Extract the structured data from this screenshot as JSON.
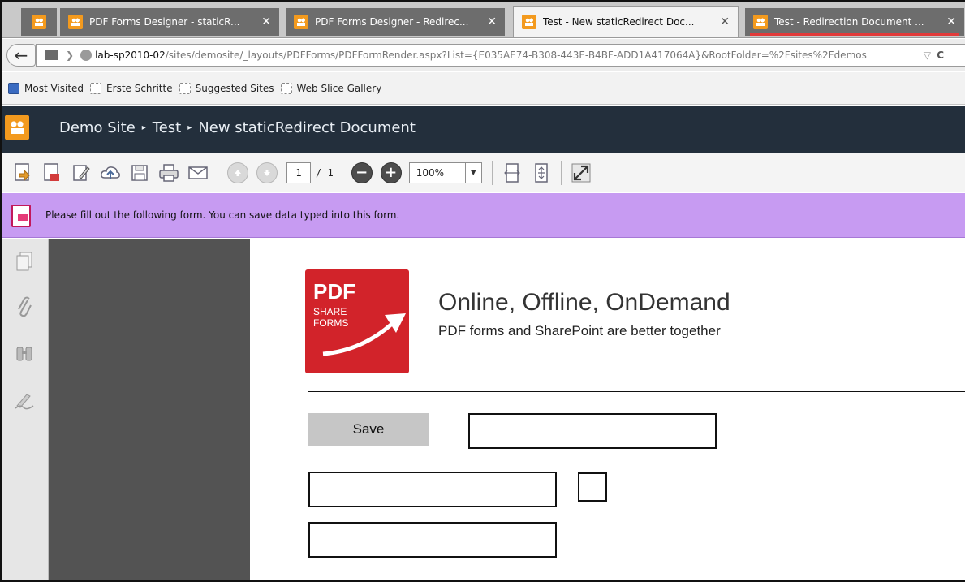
{
  "browser": {
    "tabs": [
      {
        "label": "",
        "state": "inactive"
      },
      {
        "label": "PDF Forms Designer - staticR...",
        "state": "inactive",
        "close": "✕"
      },
      {
        "label": "PDF Forms Designer - Redirec...",
        "state": "inactive",
        "close": "✕"
      },
      {
        "label": "Test - New staticRedirect Doc...",
        "state": "active",
        "close": "✕"
      },
      {
        "label": "Test - Redirection Document ...",
        "state": "inactive",
        "close": "✕"
      }
    ],
    "url_host": "lab-sp2010-02",
    "url_path": "/sites/demosite/_layouts/PDFForms/PDFFormRender.aspx?List={E035AE74-B308-443E-B4BF-ADD1A417064A}&RootFolder=%2Fsites%2Fdemos",
    "url_dropdown": "▽",
    "url_reload": "C",
    "bookmarks": [
      "Most Visited",
      "Erste Schritte",
      "Suggested Sites",
      "Web Slice Gallery"
    ]
  },
  "sharepoint": {
    "breadcrumb": [
      "Demo Site",
      "Test",
      "New staticRedirect Document"
    ],
    "separator": "▸"
  },
  "pdf_toolbar": {
    "page_current": "1",
    "page_total": "/ 1",
    "zoom": "100%",
    "zoom_minus": "−",
    "zoom_plus": "+"
  },
  "message_bar": {
    "text": "Please fill out the following form. You can save data typed into this form."
  },
  "document": {
    "logo_line1": "PDF",
    "logo_line2": "SHARE",
    "logo_line3": "FORMS",
    "headline": "Online, Offline, OnDemand",
    "tagline": "PDF forms and SharePoint are better together",
    "save_label": "Save"
  },
  "colors": {
    "tab_underline": "#e23b3b",
    "sharepoint_header": "#232f3c",
    "message_bar": "#c79bf2",
    "logo_red": "#d2232a",
    "favicon_orange": "#f39a1e"
  }
}
